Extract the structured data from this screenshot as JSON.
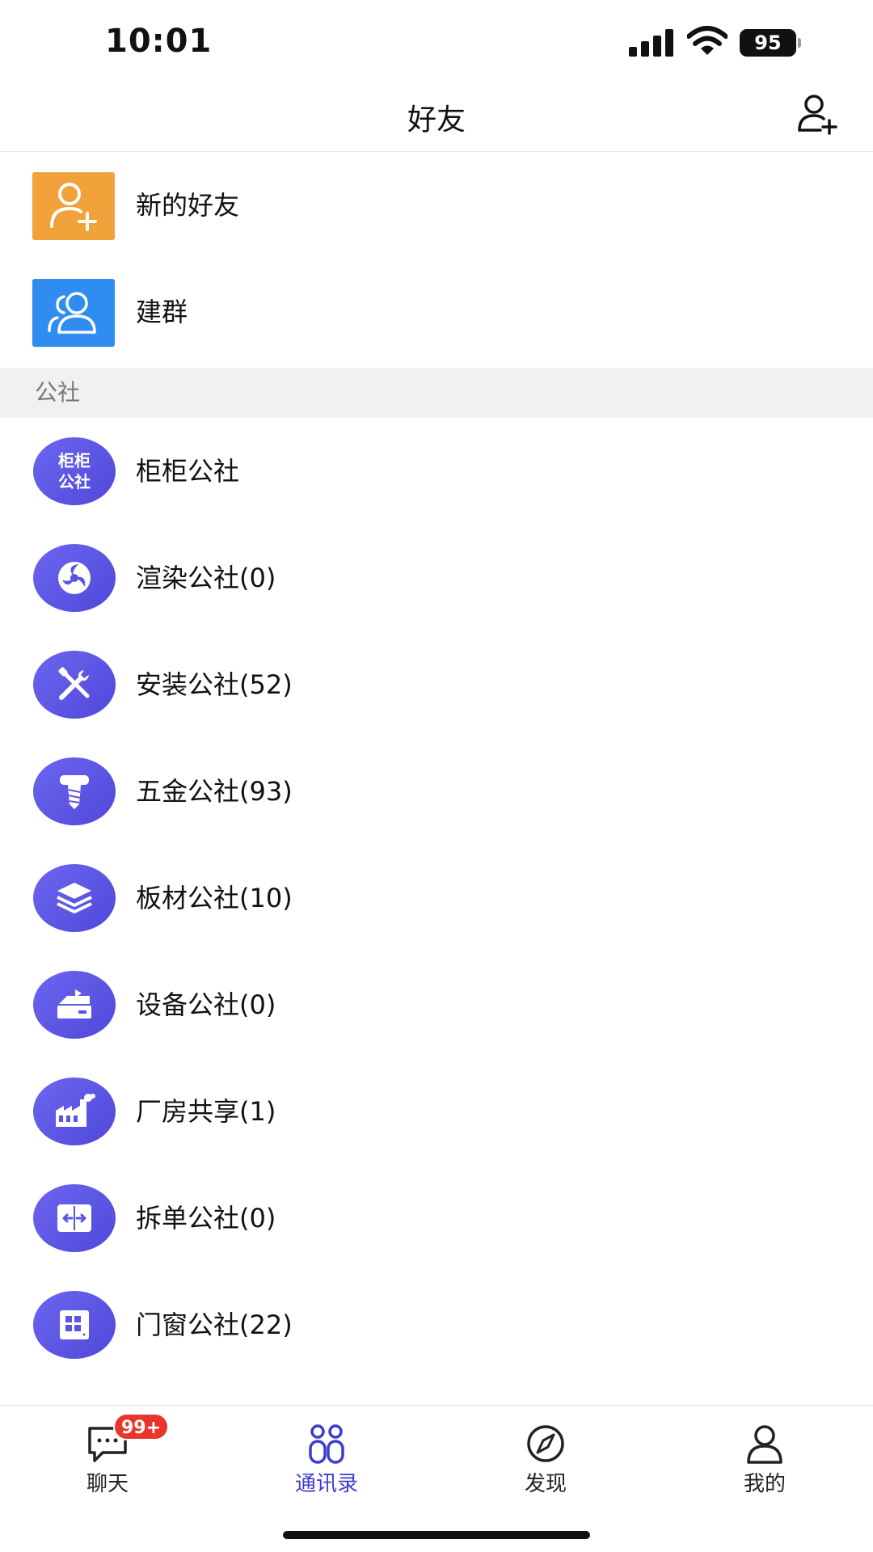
{
  "status_bar": {
    "time": "10:01",
    "battery": "95"
  },
  "header": {
    "title": "好友",
    "add_icon": "person-add-icon"
  },
  "quick_actions": [
    {
      "label": "新的好友",
      "icon": "person-add-icon",
      "color": "#F2A23A"
    },
    {
      "label": "建群",
      "icon": "group-icon",
      "color": "#2F8CF0"
    }
  ],
  "section": {
    "title": "公社"
  },
  "groups": [
    {
      "label": "柜柜公社",
      "avatar_text_1": "柜柜",
      "avatar_text_2": "公社"
    },
    {
      "label": "渲染公社(0)",
      "icon": "swirl-icon"
    },
    {
      "label": "安装公社(52)",
      "icon": "tools-icon"
    },
    {
      "label": "五金公社(93)",
      "icon": "screw-icon"
    },
    {
      "label": "板材公社(10)",
      "icon": "layers-icon"
    },
    {
      "label": "设备公社(0)",
      "icon": "machine-icon"
    },
    {
      "label": "厂房共享(1)",
      "icon": "factory-icon"
    },
    {
      "label": "拆单公社(0)",
      "icon": "split-icon"
    },
    {
      "label": "门窗公社(22)",
      "icon": "window-icon"
    }
  ],
  "tabbar": {
    "items": [
      {
        "label": "聊天",
        "icon": "chat-icon"
      },
      {
        "label": "通讯录",
        "icon": "contacts-icon",
        "active": true
      },
      {
        "label": "发现",
        "icon": "compass-icon"
      },
      {
        "label": "我的",
        "icon": "profile-icon"
      }
    ],
    "chat_badge": "99+"
  },
  "colors": {
    "accent": "#3D3DCC",
    "avatar_gradient_start": "#6B66F0",
    "avatar_gradient_end": "#5048D9",
    "badge": "#E8352E"
  }
}
